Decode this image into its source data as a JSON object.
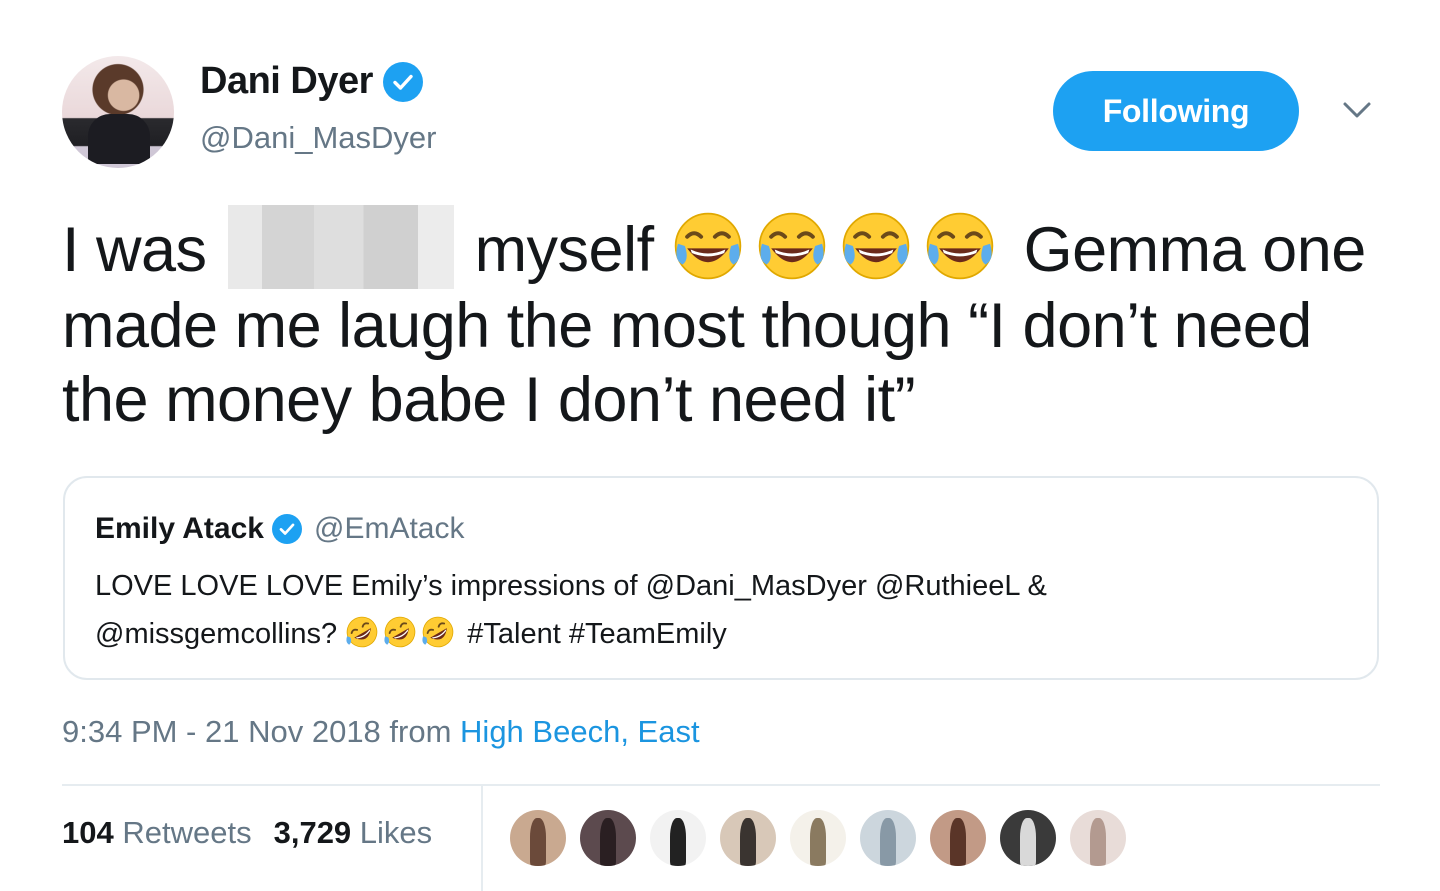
{
  "author": {
    "display_name": "Dani Dyer",
    "handle": "@Dani_MasDyer",
    "verified": true
  },
  "follow_button_label": "Following",
  "tweet": {
    "text_part1": "I was",
    "text_part2": "myself",
    "text_part3": "Gemma one made me laugh the most though “I don’t need the money babe I don’t need it”",
    "emoji_part1": [
      "face-with-tears-of-joy",
      "face-with-tears-of-joy",
      "face-with-tears-of-joy",
      "face-with-tears-of-joy"
    ]
  },
  "quoted_tweet": {
    "display_name": "Emily Atack",
    "handle": "@EmAtack",
    "verified": true,
    "text_line1": "LOVE LOVE LOVE Emily’s impressions of @Dani_MasDyer @RuthieeL &",
    "text_line2_start": "@missgemcollins?",
    "emoji": [
      "rolling-on-floor-laughing",
      "rolling-on-floor-laughing",
      "rolling-on-floor-laughing"
    ],
    "text_line2_end": "#Talent #TeamEmily"
  },
  "meta": {
    "timestamp": "9:34 PM - 21 Nov 2018",
    "from_label": "from",
    "location": "High Beech, East"
  },
  "stats": {
    "retweets_count": "104",
    "retweets_label": "Retweets",
    "likes_count": "3,729",
    "likes_label": "Likes"
  },
  "likers": [
    {
      "name": "liker-avatar-1",
      "bg": "#c9a990",
      "fig": "#6b4a3a"
    },
    {
      "name": "liker-avatar-2",
      "bg": "#5c4a4e",
      "fig": "#2a1f22"
    },
    {
      "name": "liker-avatar-3",
      "bg": "#f2f2f2",
      "fig": "#222222"
    },
    {
      "name": "liker-avatar-4",
      "bg": "#d8c8b8",
      "fig": "#3a3430"
    },
    {
      "name": "liker-avatar-5",
      "bg": "#f4f1ea",
      "fig": "#8a7a60"
    },
    {
      "name": "liker-avatar-6",
      "bg": "#ccd6dd",
      "fig": "#8899a6"
    },
    {
      "name": "liker-avatar-7",
      "bg": "#c29a86",
      "fig": "#5a3528"
    },
    {
      "name": "liker-avatar-8",
      "bg": "#3a3a3a",
      "fig": "#d9d9d9"
    },
    {
      "name": "liker-avatar-9",
      "bg": "#e8dcd8",
      "fig": "#b39a90"
    }
  ]
}
